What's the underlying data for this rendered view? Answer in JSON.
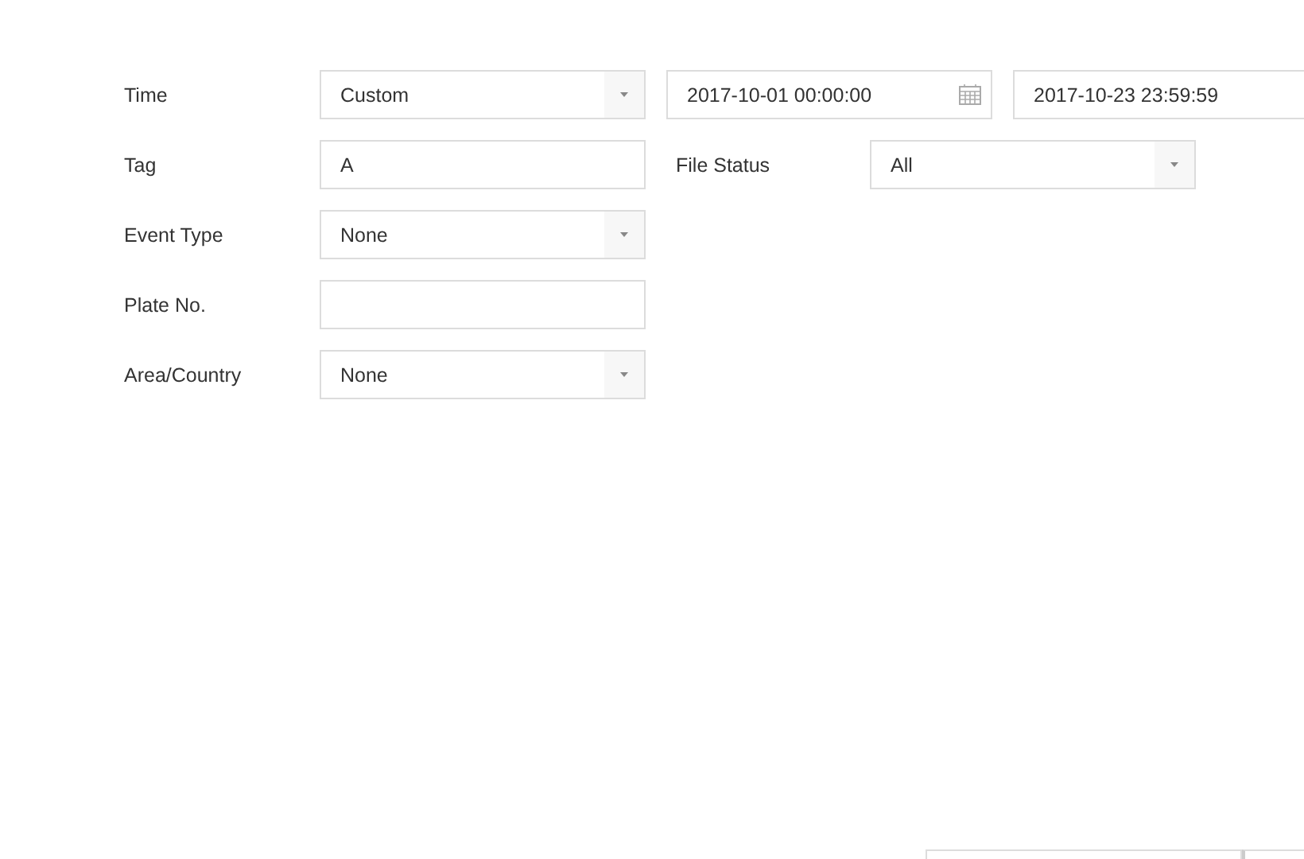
{
  "form": {
    "rows": [
      {
        "label": "Time",
        "items": [
          {
            "kind": "select",
            "value": "Custom"
          },
          {
            "kind": "date",
            "value": "2017-10-01 00:00:00"
          },
          {
            "kind": "date-cut",
            "value": "2017-10-23 23:59:59"
          }
        ]
      },
      {
        "label": "Tag",
        "items": [
          {
            "kind": "text",
            "value": "A"
          },
          {
            "kind": "label",
            "value": "File Status"
          },
          {
            "kind": "select",
            "value": "All"
          }
        ]
      },
      {
        "label": "Event Type",
        "items": [
          {
            "kind": "select",
            "value": "None"
          }
        ]
      },
      {
        "label": "Plate No.",
        "items": [
          {
            "kind": "text",
            "value": ""
          }
        ]
      },
      {
        "label": "Area/Country",
        "items": [
          {
            "kind": "select",
            "value": "None"
          }
        ]
      }
    ]
  },
  "footer": {
    "buttons": [
      {
        "kind": "wide"
      },
      {
        "kind": "narrow"
      }
    ]
  }
}
